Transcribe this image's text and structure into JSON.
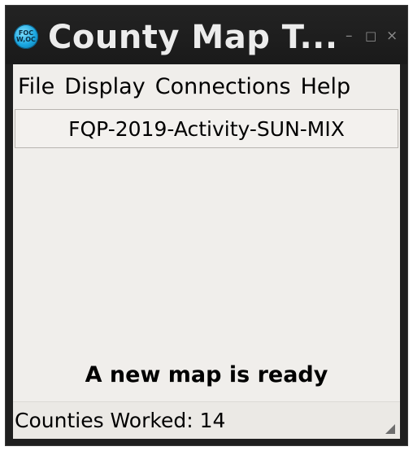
{
  "window": {
    "title": "County Map T...",
    "app_icon_text": "FOC",
    "app_icon_subtext": "W,OC",
    "minimize_glyph": "–",
    "maximize_glyph": "□",
    "close_glyph": "×"
  },
  "menubar": {
    "items": [
      {
        "label": "File"
      },
      {
        "label": "Display"
      },
      {
        "label": "Connections"
      },
      {
        "label": "Help"
      }
    ]
  },
  "activity": {
    "name": "FQP-2019-Activity-SUN-MIX"
  },
  "map": {
    "status_message": "A new map is ready"
  },
  "statusbar": {
    "counties_worked": "Counties Worked: 14"
  },
  "colors": {
    "titlebar": "#1f1f1f",
    "client_background": "#f0eeeb",
    "app_icon_accent": "#1aa6e0"
  }
}
